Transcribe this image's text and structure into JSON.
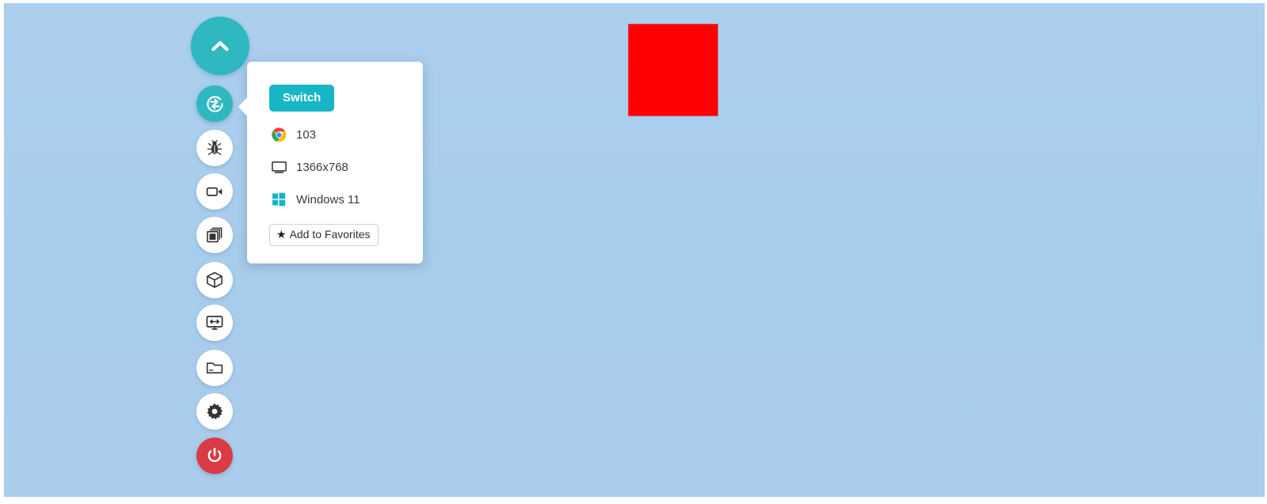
{
  "theme": {
    "background": "#a9cdec",
    "accent_teal": "#2fb8c0",
    "switch_button": "#17b6c7",
    "power_red": "#db3b45",
    "content_square": "#ff0000"
  },
  "content": {
    "square_label": "red-square"
  },
  "toolbar": {
    "collapse": {
      "name": "collapse-toolbar-button",
      "icon": "chevron-up-icon"
    },
    "items": [
      {
        "name": "switch-browser-button",
        "icon": "switch-arrows-icon",
        "state": "active"
      },
      {
        "name": "bug-report-button",
        "icon": "bug-icon",
        "state": "default"
      },
      {
        "name": "record-video-button",
        "icon": "video-camera-icon",
        "state": "default"
      },
      {
        "name": "screenshots-button",
        "icon": "copies-icon",
        "state": "default"
      },
      {
        "name": "device-cube-button",
        "icon": "cube-icon",
        "state": "default"
      },
      {
        "name": "resize-screen-button",
        "icon": "monitor-resize-icon",
        "state": "default"
      },
      {
        "name": "local-files-button",
        "icon": "folder-icon",
        "state": "default"
      },
      {
        "name": "settings-button",
        "icon": "gear-icon",
        "state": "default"
      },
      {
        "name": "stop-session-button",
        "icon": "power-icon",
        "state": "danger"
      }
    ]
  },
  "popover": {
    "switch_label": "Switch",
    "details": [
      {
        "icon": "chrome-icon",
        "label": "103"
      },
      {
        "icon": "monitor-icon",
        "label": "1366x768"
      },
      {
        "icon": "windows-icon",
        "label": "Windows 11"
      }
    ],
    "favorites_star": "★",
    "favorites_label": "Add to Favorites"
  }
}
